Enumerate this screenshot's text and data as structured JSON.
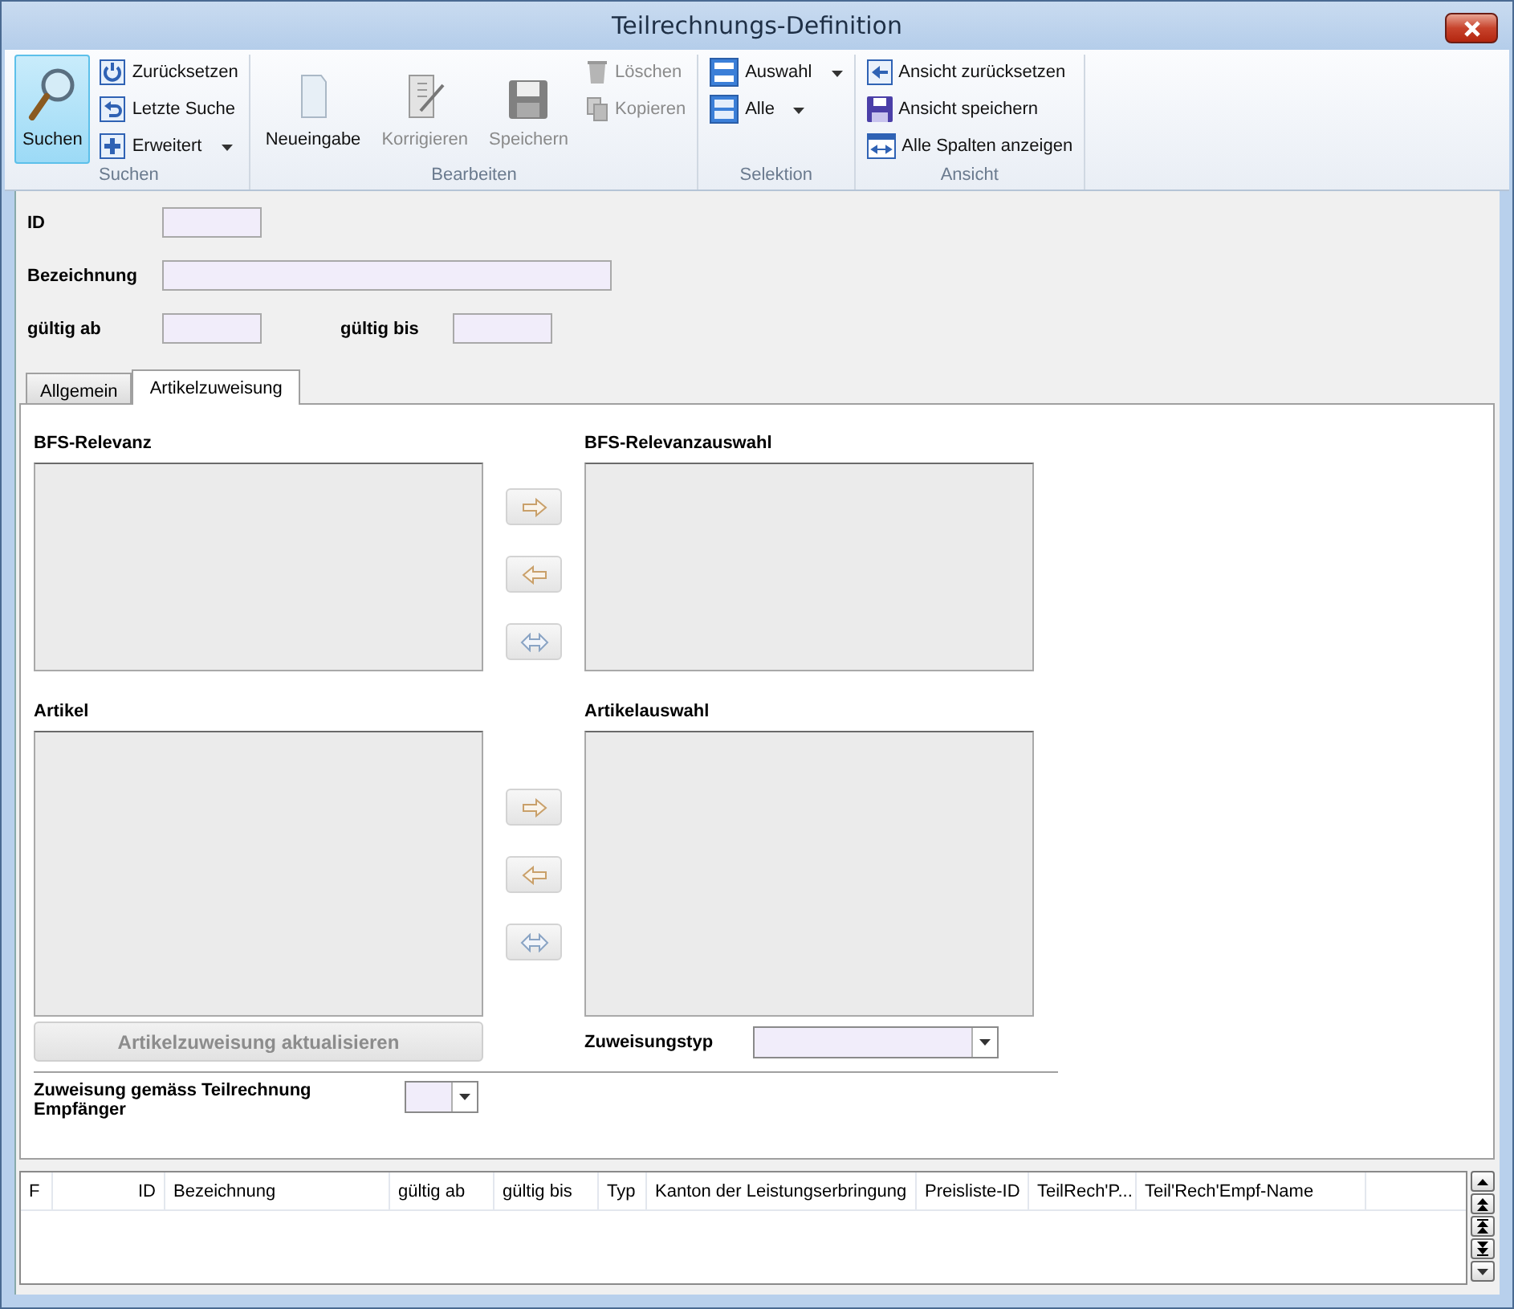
{
  "window": {
    "title": "Teilrechnungs-Definition"
  },
  "ribbon": {
    "groups": [
      {
        "label": "Suchen",
        "items": [
          {
            "kind": "large",
            "label": "Suchen",
            "selected": true,
            "disabled": false
          },
          {
            "kind": "small",
            "label": "Zurücksetzen",
            "disabled": false
          },
          {
            "kind": "small",
            "label": "Letzte Suche",
            "disabled": false
          },
          {
            "kind": "small",
            "label": "Erweitert",
            "disabled": false,
            "dropdown": true
          }
        ]
      },
      {
        "label": "Bearbeiten",
        "items": [
          {
            "kind": "large",
            "label": "Neueingabe",
            "selected": false,
            "disabled": false
          },
          {
            "kind": "large",
            "label": "Korrigieren",
            "selected": false,
            "disabled": true
          },
          {
            "kind": "large",
            "label": "Speichern",
            "selected": false,
            "disabled": true
          },
          {
            "kind": "small",
            "label": "Löschen",
            "disabled": true
          },
          {
            "kind": "small",
            "label": "Kopieren",
            "disabled": true
          }
        ]
      },
      {
        "label": "Selektion",
        "items": [
          {
            "kind": "small",
            "label": "Auswahl",
            "disabled": false,
            "dropdown": true
          },
          {
            "kind": "small",
            "label": "Alle",
            "disabled": false,
            "dropdown": true
          }
        ]
      },
      {
        "label": "Ansicht",
        "items": [
          {
            "kind": "small",
            "label": "Ansicht zurücksetzen",
            "disabled": false
          },
          {
            "kind": "small",
            "label": "Ansicht speichern",
            "disabled": false
          },
          {
            "kind": "small",
            "label": "Alle Spalten anzeigen",
            "disabled": false
          }
        ]
      }
    ]
  },
  "form": {
    "rows": [
      [
        {
          "label": "ID"
        }
      ],
      [
        {
          "label": "Bezeichnung"
        }
      ],
      [
        {
          "label": "gültig ab"
        },
        {
          "label": "gültig bis"
        }
      ]
    ]
  },
  "tabs": [
    {
      "label": "Allgemein",
      "selected": false
    },
    {
      "label": "Artikelzuweisung",
      "selected": true
    }
  ],
  "transfers": [
    {
      "source_label": "BFS-Relevanz",
      "target_label": "BFS-Relevanzauswahl"
    },
    {
      "source_label": "Artikel",
      "target_label": "Artikelauswahl"
    }
  ],
  "update_button": {
    "label": "Artikelzuweisung aktualisieren",
    "disabled": true
  },
  "assignment_type": {
    "label": "Zuweisungstyp"
  },
  "recipient_assignment": {
    "label": "Zuweisung gemäss Teilrechnung Empfänger"
  },
  "table": {
    "columns": [
      {
        "label": "F"
      },
      {
        "label": "ID"
      },
      {
        "label": "Bezeichnung"
      },
      {
        "label": "gültig ab"
      },
      {
        "label": "gültig bis"
      },
      {
        "label": "Typ"
      },
      {
        "label": "Kanton der Leistungserbringung"
      },
      {
        "label": "Preisliste-ID"
      },
      {
        "label": "TeilRech'P..."
      },
      {
        "label": "Teil'Rech'Empf-Name"
      }
    ]
  }
}
